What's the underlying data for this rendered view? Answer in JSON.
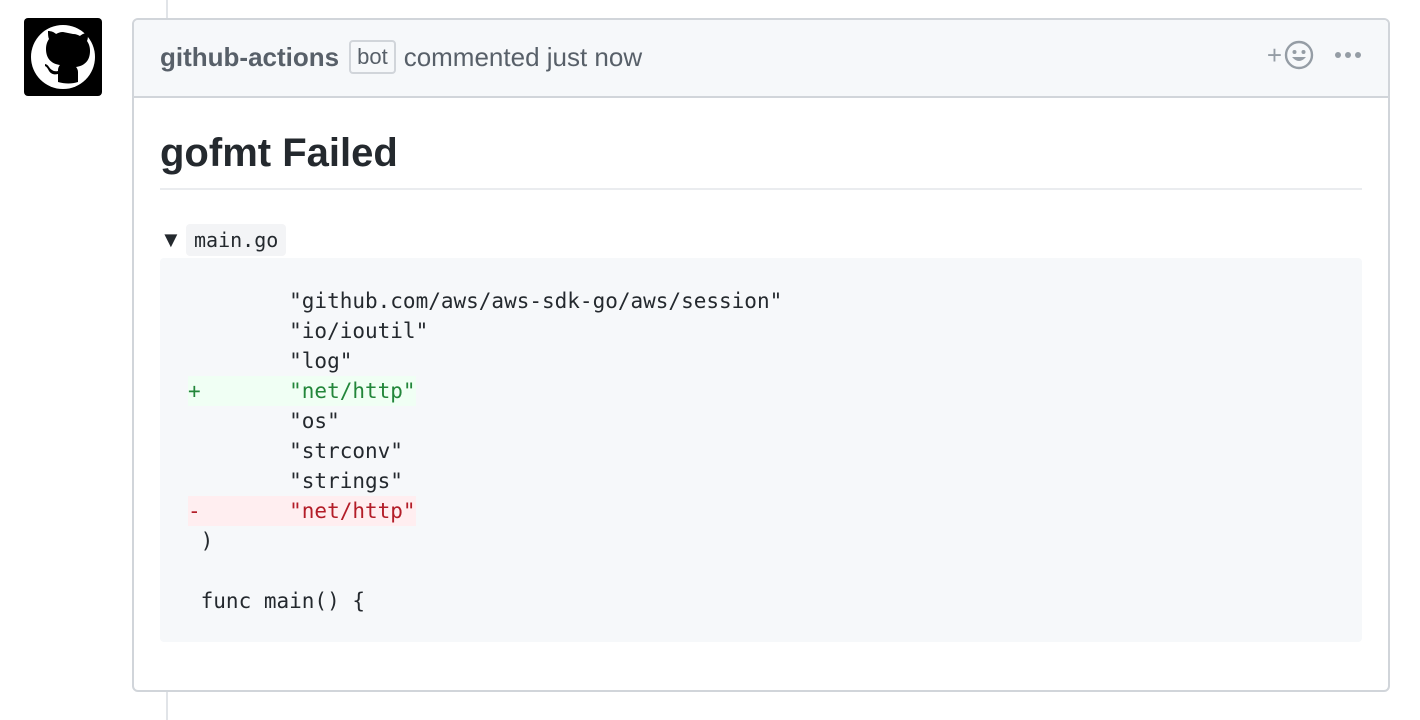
{
  "comment": {
    "author": "github-actions",
    "badge": "bot",
    "meta": "commented just now",
    "reaction_plus": "+",
    "title": "gofmt Failed",
    "file": {
      "toggle": "▼",
      "name": "main.go"
    },
    "diff_lines": [
      {
        "type": "ctx",
        "text": "        \"github.com/aws/aws-sdk-go/aws/session\""
      },
      {
        "type": "ctx",
        "text": "        \"io/ioutil\""
      },
      {
        "type": "ctx",
        "text": "        \"log\""
      },
      {
        "type": "add",
        "text": "+       \"net/http\""
      },
      {
        "type": "ctx",
        "text": "        \"os\""
      },
      {
        "type": "ctx",
        "text": "        \"strconv\""
      },
      {
        "type": "ctx",
        "text": "        \"strings\""
      },
      {
        "type": "del",
        "text": "-       \"net/http\""
      },
      {
        "type": "ctx",
        "text": " )"
      },
      {
        "type": "ctx",
        "text": ""
      },
      {
        "type": "ctx",
        "text": " func main() {"
      }
    ]
  },
  "icons": {
    "avatar": "github-octocat-icon",
    "reaction": "smiley-icon",
    "more": "kebab-horizontal-icon"
  },
  "colors": {
    "add_text": "#22863a",
    "add_bg": "#f0fff4",
    "del_text": "#b31d28",
    "del_bg": "#ffeef0"
  }
}
